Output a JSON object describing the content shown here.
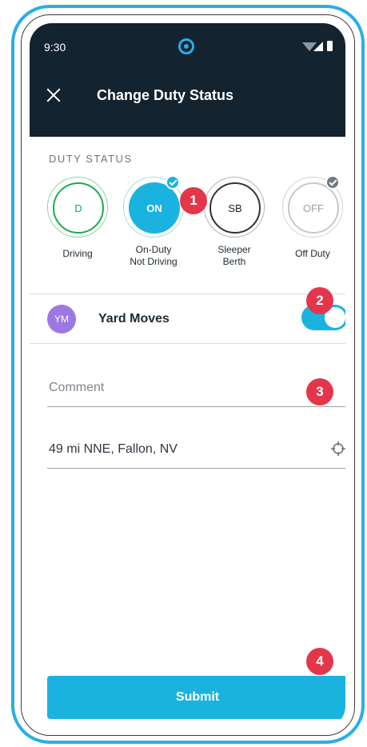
{
  "status_bar": {
    "time": "9:30"
  },
  "header": {
    "title": "Change Duty Status",
    "close_icon": "close-icon"
  },
  "duty_status": {
    "label": "DUTY STATUS",
    "selected": "ON",
    "options": [
      {
        "code": "D",
        "label_line1": "Driving",
        "label_line2": ""
      },
      {
        "code": "ON",
        "label_line1": "On-Duty",
        "label_line2": "Not Driving"
      },
      {
        "code": "SB",
        "label_line1": "Sleeper",
        "label_line2": "Berth"
      },
      {
        "code": "OFF",
        "label_line1": "Off Duty",
        "label_line2": ""
      }
    ]
  },
  "yard_moves": {
    "avatar": "YM",
    "label": "Yard Moves",
    "enabled": true
  },
  "comment": {
    "placeholder": "Comment",
    "value": ""
  },
  "location": {
    "value": "49 mi NNE, Fallon, NV",
    "icon": "crosshair-icon"
  },
  "submit": {
    "label": "Submit"
  },
  "badges": [
    "1",
    "2",
    "3",
    "4"
  ],
  "colors": {
    "header_bg": "#132330",
    "accent": "#1ab3e0",
    "driving": "#1faa4f",
    "badge": "#e3364b",
    "avatar": "#9b79e0",
    "frame": "#29aee6"
  }
}
